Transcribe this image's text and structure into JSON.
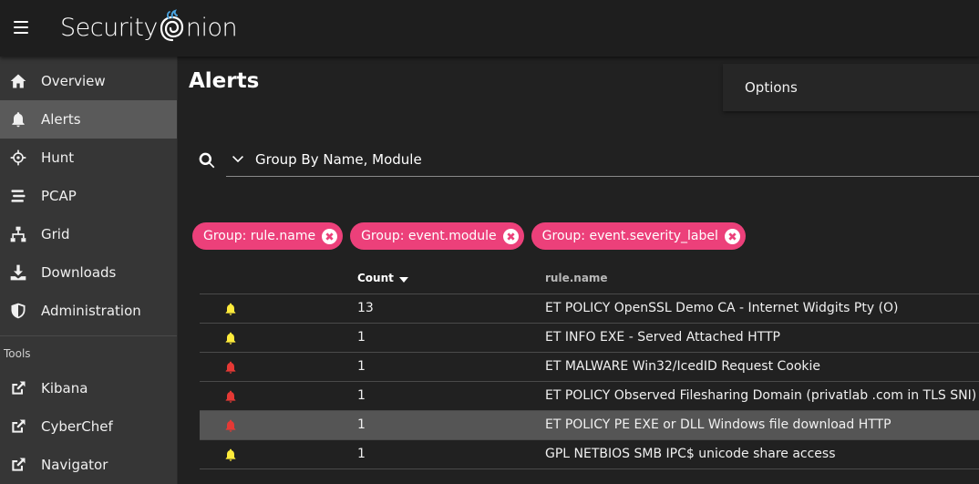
{
  "app": {
    "brand_left": "Security",
    "brand_right": "nion"
  },
  "sidebar": {
    "items": [
      {
        "label": "Overview",
        "icon": "home-icon"
      },
      {
        "label": "Alerts",
        "icon": "bell-icon",
        "active": true
      },
      {
        "label": "Hunt",
        "icon": "crosshairs-icon"
      },
      {
        "label": "PCAP",
        "icon": "stream-icon"
      },
      {
        "label": "Grid",
        "icon": "sitemap-icon"
      },
      {
        "label": "Downloads",
        "icon": "download-icon"
      },
      {
        "label": "Administration",
        "icon": "shield-icon"
      }
    ],
    "tools_label": "Tools",
    "tools": [
      {
        "label": "Kibana",
        "icon": "external-link-icon"
      },
      {
        "label": "CyberChef",
        "icon": "external-link-icon"
      },
      {
        "label": "Navigator",
        "icon": "external-link-icon"
      }
    ]
  },
  "main": {
    "title": "Alerts",
    "options_label": "Options",
    "query": "Group By Name, Module",
    "chips": [
      "Group: rule.name",
      "Group: event.module",
      "Group: event.severity_label"
    ],
    "table": {
      "headers": {
        "count": "Count",
        "name": "rule.name"
      },
      "rows": [
        {
          "severity": "medium",
          "count": "13",
          "name": "ET POLICY OpenSSL Demo CA - Internet Widgits Pty (O)"
        },
        {
          "severity": "medium",
          "count": "1",
          "name": "ET INFO EXE - Served Attached HTTP"
        },
        {
          "severity": "high",
          "count": "1",
          "name": "ET MALWARE Win32/IcedID Request Cookie"
        },
        {
          "severity": "high",
          "count": "1",
          "name": "ET POLICY Observed Filesharing Domain (privatlab .com in TLS SNI)"
        },
        {
          "severity": "high",
          "count": "1",
          "name": "ET POLICY PE EXE or DLL Windows file download HTTP",
          "highlight": true
        },
        {
          "severity": "medium",
          "count": "1",
          "name": "GPL NETBIOS SMB IPC$ unicode share access"
        }
      ]
    }
  },
  "colors": {
    "chip": "#ec407a",
    "severity_medium": "#ffeb3b",
    "severity_high": "#e53935",
    "sidebar_bg": "#363636",
    "sidebar_active": "#5a5a5a"
  }
}
